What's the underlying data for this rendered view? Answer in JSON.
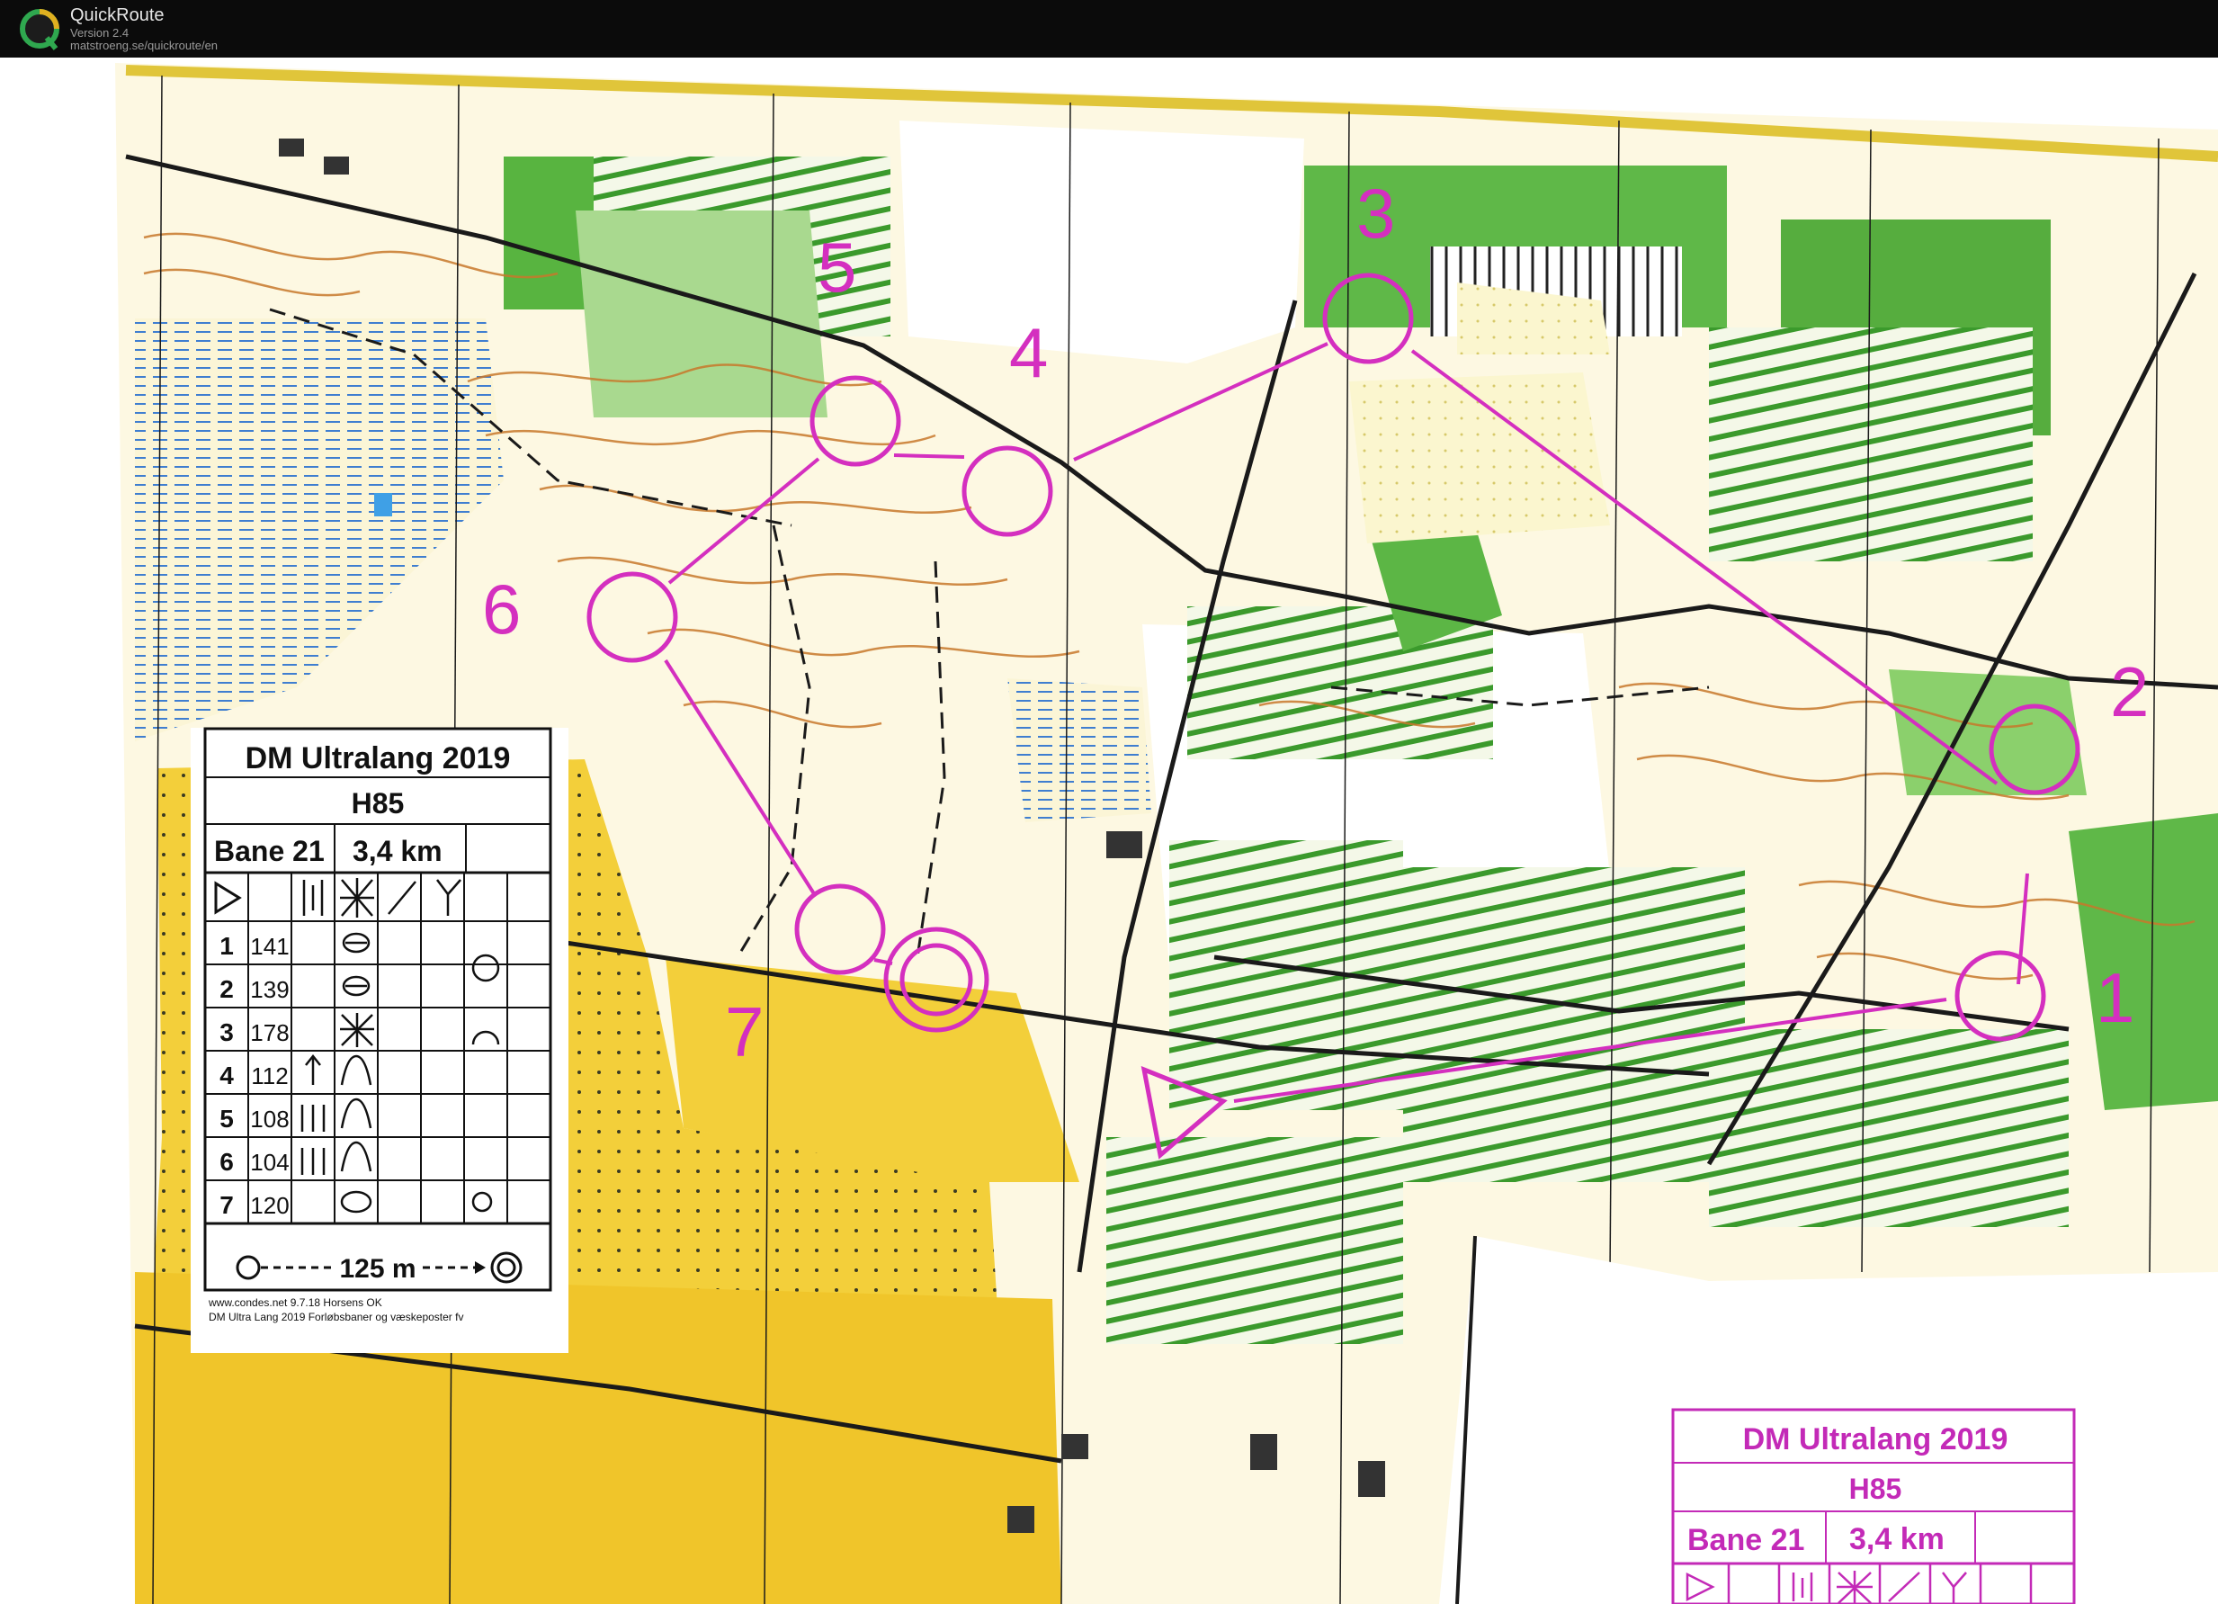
{
  "window": {
    "title": "QuickRoute",
    "version": "Version 2.4",
    "url": "matstroeng.se/quickroute/en"
  },
  "map": {
    "course_color": "#d42fbf",
    "control_numbers": [
      "1",
      "2",
      "3",
      "4",
      "5",
      "6",
      "7"
    ]
  },
  "control_description": {
    "event": "DM Ultralang 2019",
    "class": "H85",
    "course": "Bane 21",
    "length": "3,4 km",
    "rows": [
      {
        "num": "1",
        "code": "141"
      },
      {
        "num": "2",
        "code": "139"
      },
      {
        "num": "3",
        "code": "178"
      },
      {
        "num": "4",
        "code": "112"
      },
      {
        "num": "5",
        "code": "108"
      },
      {
        "num": "6",
        "code": "104"
      },
      {
        "num": "7",
        "code": "120"
      }
    ],
    "finish_distance": "125 m",
    "footer_line1": "www.condes.net 9.7.18 Horsens OK",
    "footer_line2": "DM Ultra Lang 2019 Forløbsbaner og væskeposter fv"
  },
  "control_description_2": {
    "event": "DM Ultralang 2019",
    "class": "H85",
    "course": "Bane 21",
    "length": "3,4 km"
  }
}
